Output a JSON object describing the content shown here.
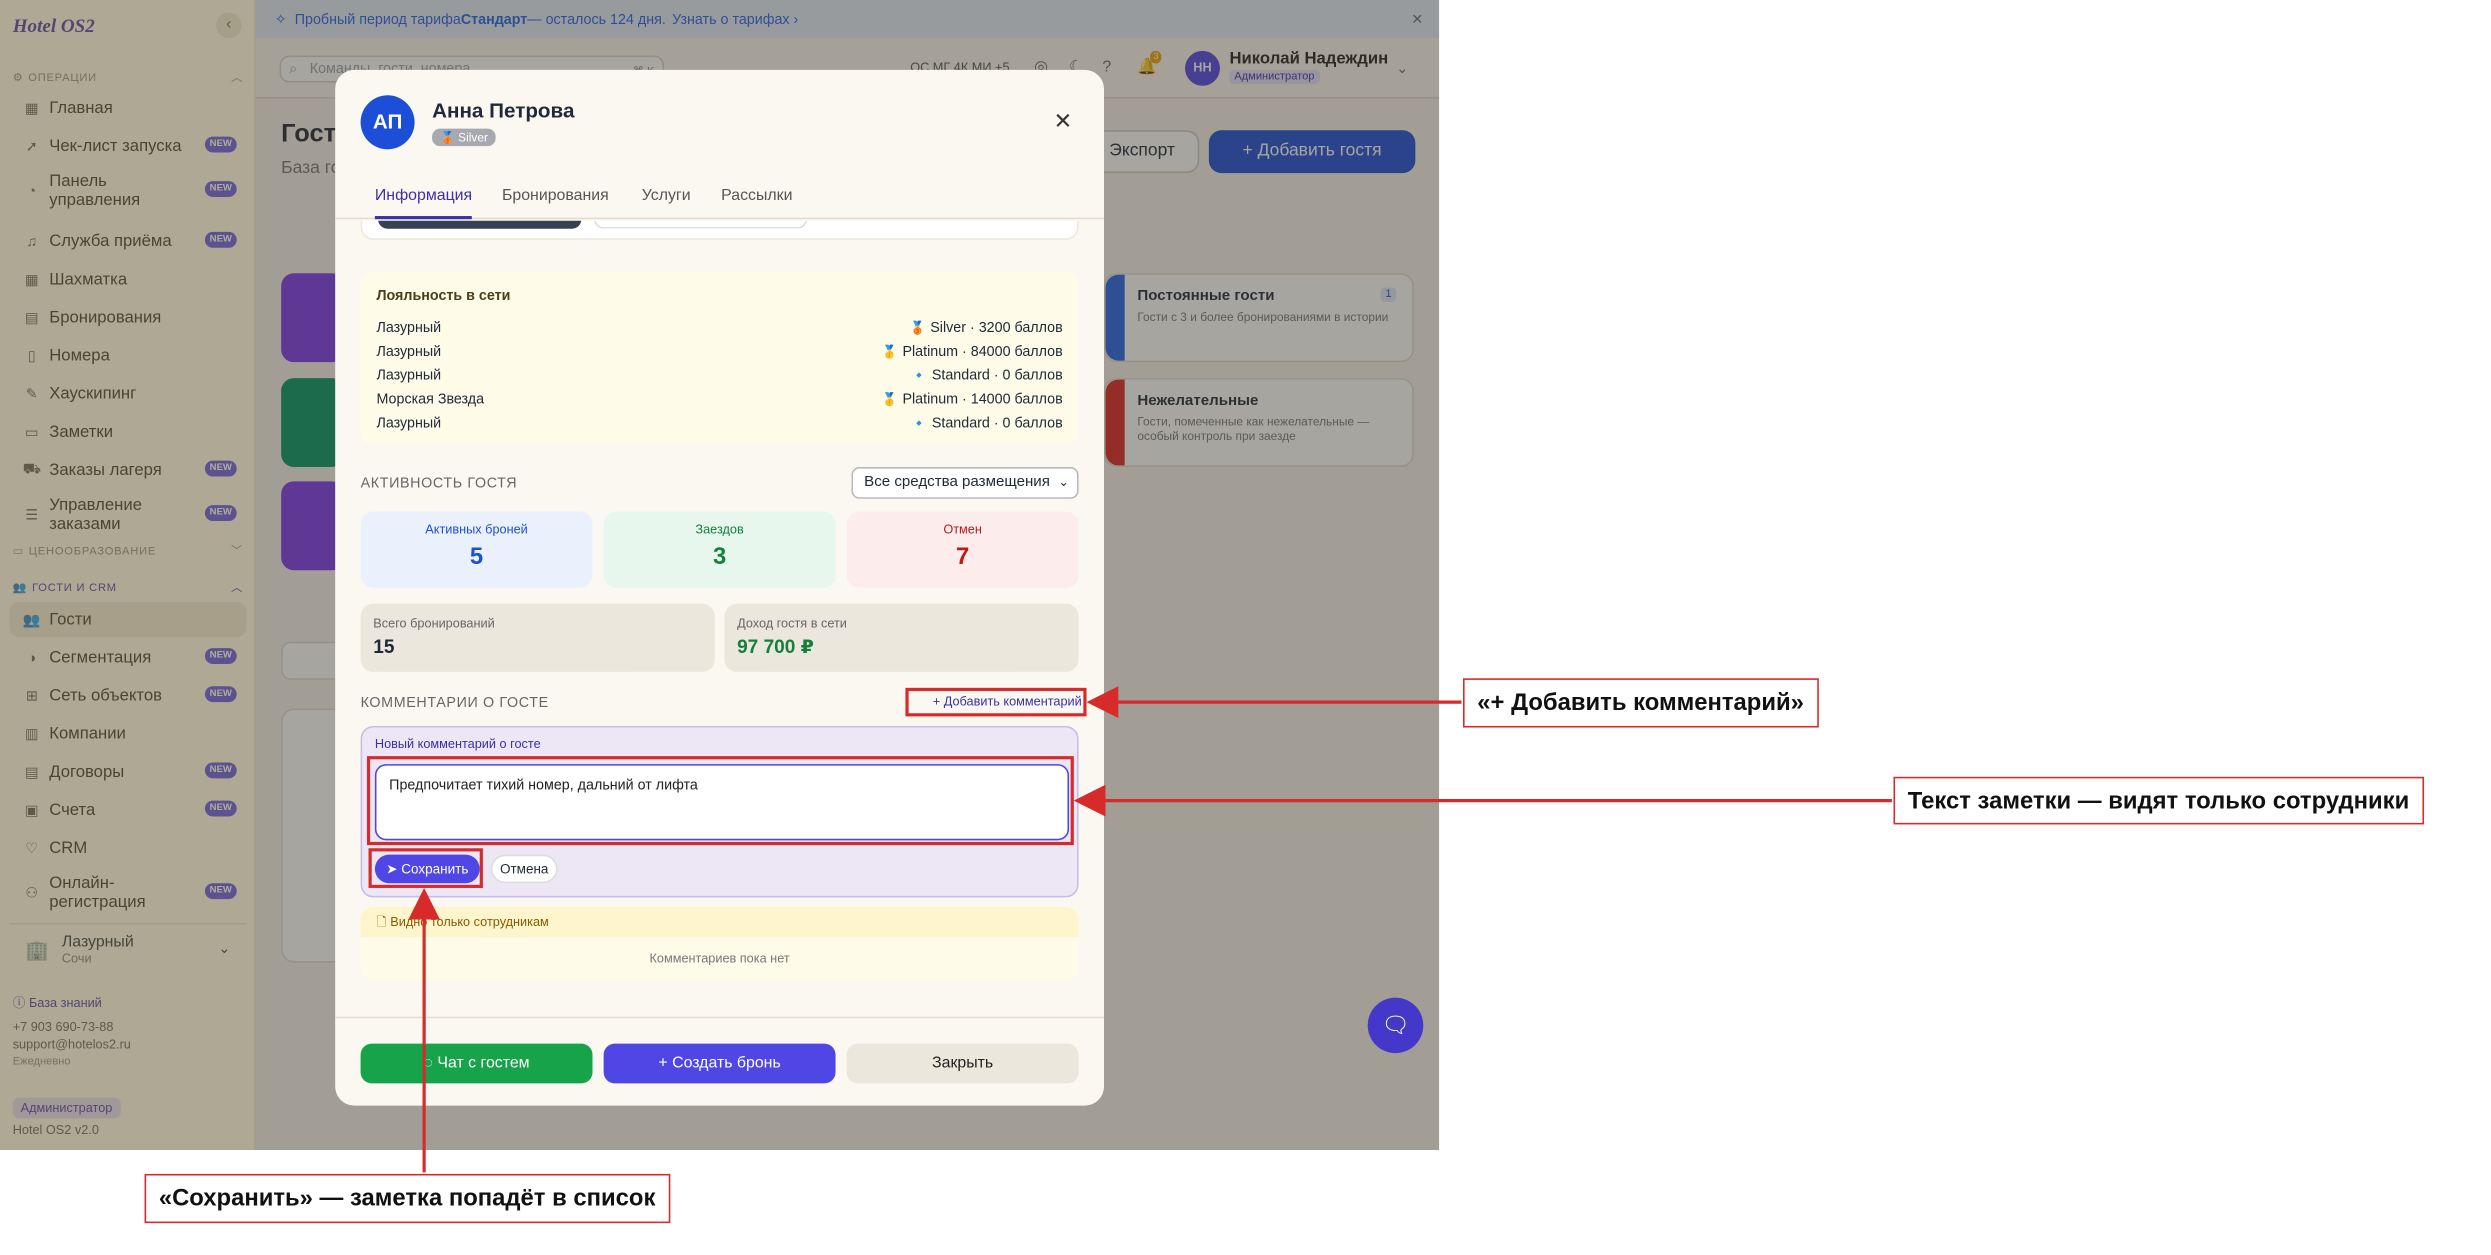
{
  "sidebar": {
    "logo": "Hotel OS2",
    "sections": {
      "ops": "ОПЕРАЦИИ",
      "pricing": "ЦЕНООБРАЗОВАНИЕ",
      "crm": "ГОСТИ И CRM"
    },
    "items": [
      {
        "label": "Главная",
        "icon": "grid-icon"
      },
      {
        "label": "Чек-лист запуска",
        "icon": "rocket-icon",
        "badge": "NEW"
      },
      {
        "label": "Панель управления",
        "icon": "gauge-icon",
        "badge": "NEW"
      },
      {
        "label": "Служба приёма",
        "icon": "bell-icon",
        "badge": "NEW"
      },
      {
        "label": "Шахматка",
        "icon": "calendar-grid-icon"
      },
      {
        "label": "Бронирования",
        "icon": "calendar-icon"
      },
      {
        "label": "Номера",
        "icon": "door-icon"
      },
      {
        "label": "Хаускипинг",
        "icon": "broom-icon"
      },
      {
        "label": "Заметки",
        "icon": "note-icon"
      },
      {
        "label": "Заказы лагеря",
        "icon": "cart-icon",
        "badge": "NEW"
      },
      {
        "label": "Управление заказами",
        "icon": "list-icon",
        "badge": "NEW"
      }
    ],
    "crm_items": [
      {
        "label": "Гости",
        "icon": "users-icon"
      },
      {
        "label": "Сегментация",
        "icon": "pie-icon",
        "badge": "NEW"
      },
      {
        "label": "Сеть объектов",
        "icon": "network-icon",
        "badge": "NEW"
      },
      {
        "label": "Компании",
        "icon": "building-icon"
      },
      {
        "label": "Договоры",
        "icon": "doc-icon",
        "badge": "NEW"
      },
      {
        "label": "Счета",
        "icon": "invoice-icon",
        "badge": "NEW"
      },
      {
        "label": "CRM",
        "icon": "heart-icon"
      },
      {
        "label": "Онлайн-регистрация",
        "icon": "user-check-icon",
        "badge": "NEW"
      }
    ],
    "hotel": {
      "name": "Лазурный",
      "city": "Сочи"
    },
    "footer": {
      "kb": "База знаний",
      "phone": "+7 903 690-73-88",
      "email": "support@hotelos2.ru",
      "hours": "Ежедневно",
      "role": "Администратор",
      "version": "Hotel OS2 v2.0"
    }
  },
  "banner": {
    "pre": "Пробный период тарифа ",
    "plan": "Стандарт",
    "post": " — осталось 124 дня. ",
    "link": "Узнать о тарифах ›"
  },
  "topbar": {
    "search_placeholder": "Команды, гости, номера...",
    "kbd": "⌘ K",
    "clock": "ОС МГ 4К МИ +5",
    "notif_count": "3",
    "user_initials": "НН",
    "user_name": "Николай Надеждин",
    "user_role": "Администратор"
  },
  "page": {
    "title": "Гости",
    "subtitle": "База гостей",
    "export_label": "Экспорт",
    "add_label": "+ Добавить гостя",
    "segments": [
      {
        "title": "Постоянные гости",
        "desc": "Гости с 3 и более бронированиями в истории",
        "count": "1",
        "color": "#2563eb"
      },
      {
        "title": "Нежелательные",
        "desc": "Гости, помеченные как нежелательные — особый контроль при заезде",
        "color": "#dc2626"
      }
    ]
  },
  "modal": {
    "initials": "АП",
    "name": "Анна Петрова",
    "tier": "Silver",
    "tabs": [
      "Информация",
      "Бронирования",
      "Услуги",
      "Рассылки"
    ],
    "loyalty": {
      "title": "Лояльность в сети",
      "rows": [
        {
          "hotel": "Лазурный",
          "medal": "🥉",
          "status": "Silver · 3200 баллов"
        },
        {
          "hotel": "Лазурный",
          "medal": "🥇",
          "status": "Platinum · 84000 баллов"
        },
        {
          "hotel": "Лазурный",
          "medal": "🔹",
          "status": "Standard · 0 баллов"
        },
        {
          "hotel": "Морская Звезда",
          "medal": "🥇",
          "status": "Platinum · 14000 баллов"
        },
        {
          "hotel": "Лазурный",
          "medal": "🔹",
          "status": "Standard · 0 баллов"
        }
      ]
    },
    "activity": {
      "label": "АКТИВНОСТЬ ГОСТЯ",
      "filter": "Все средства размещения",
      "stats": [
        {
          "label": "Активных броней",
          "value": "5",
          "color": "#1d4ed8",
          "bg": "#eaf1fd"
        },
        {
          "label": "Заездов",
          "value": "3",
          "color": "#15803d",
          "bg": "#e8f7ee"
        },
        {
          "label": "Отмен",
          "value": "7",
          "color": "#b91c1c",
          "bg": "#fdecec"
        }
      ],
      "total_bookings_label": "Всего бронирований",
      "total_bookings": "15",
      "revenue_label": "Доход гостя в сети",
      "revenue": "97 700 ₽"
    },
    "comments": {
      "label": "КОММЕНТАРИИ О ГОСТЕ",
      "add_label": "+ Добавить комментарий",
      "new_label": "Новый комментарий о госте",
      "text": "Предпочитает тихий номер, дальний от лифта",
      "save_label": "Сохранить",
      "cancel_label": "Отмена",
      "visibility": "Видно только сотрудникам",
      "empty": "Комментариев пока нет"
    },
    "footer": {
      "chat": "Чат с гостем",
      "book": "+ Создать бронь",
      "close": "Закрыть"
    }
  },
  "annotations": {
    "add_comment": "«+ Добавить комментарий»",
    "note_text": "Текст заметки — видят только сотрудники",
    "save": "«Сохранить» — заметка попадёт в список"
  }
}
